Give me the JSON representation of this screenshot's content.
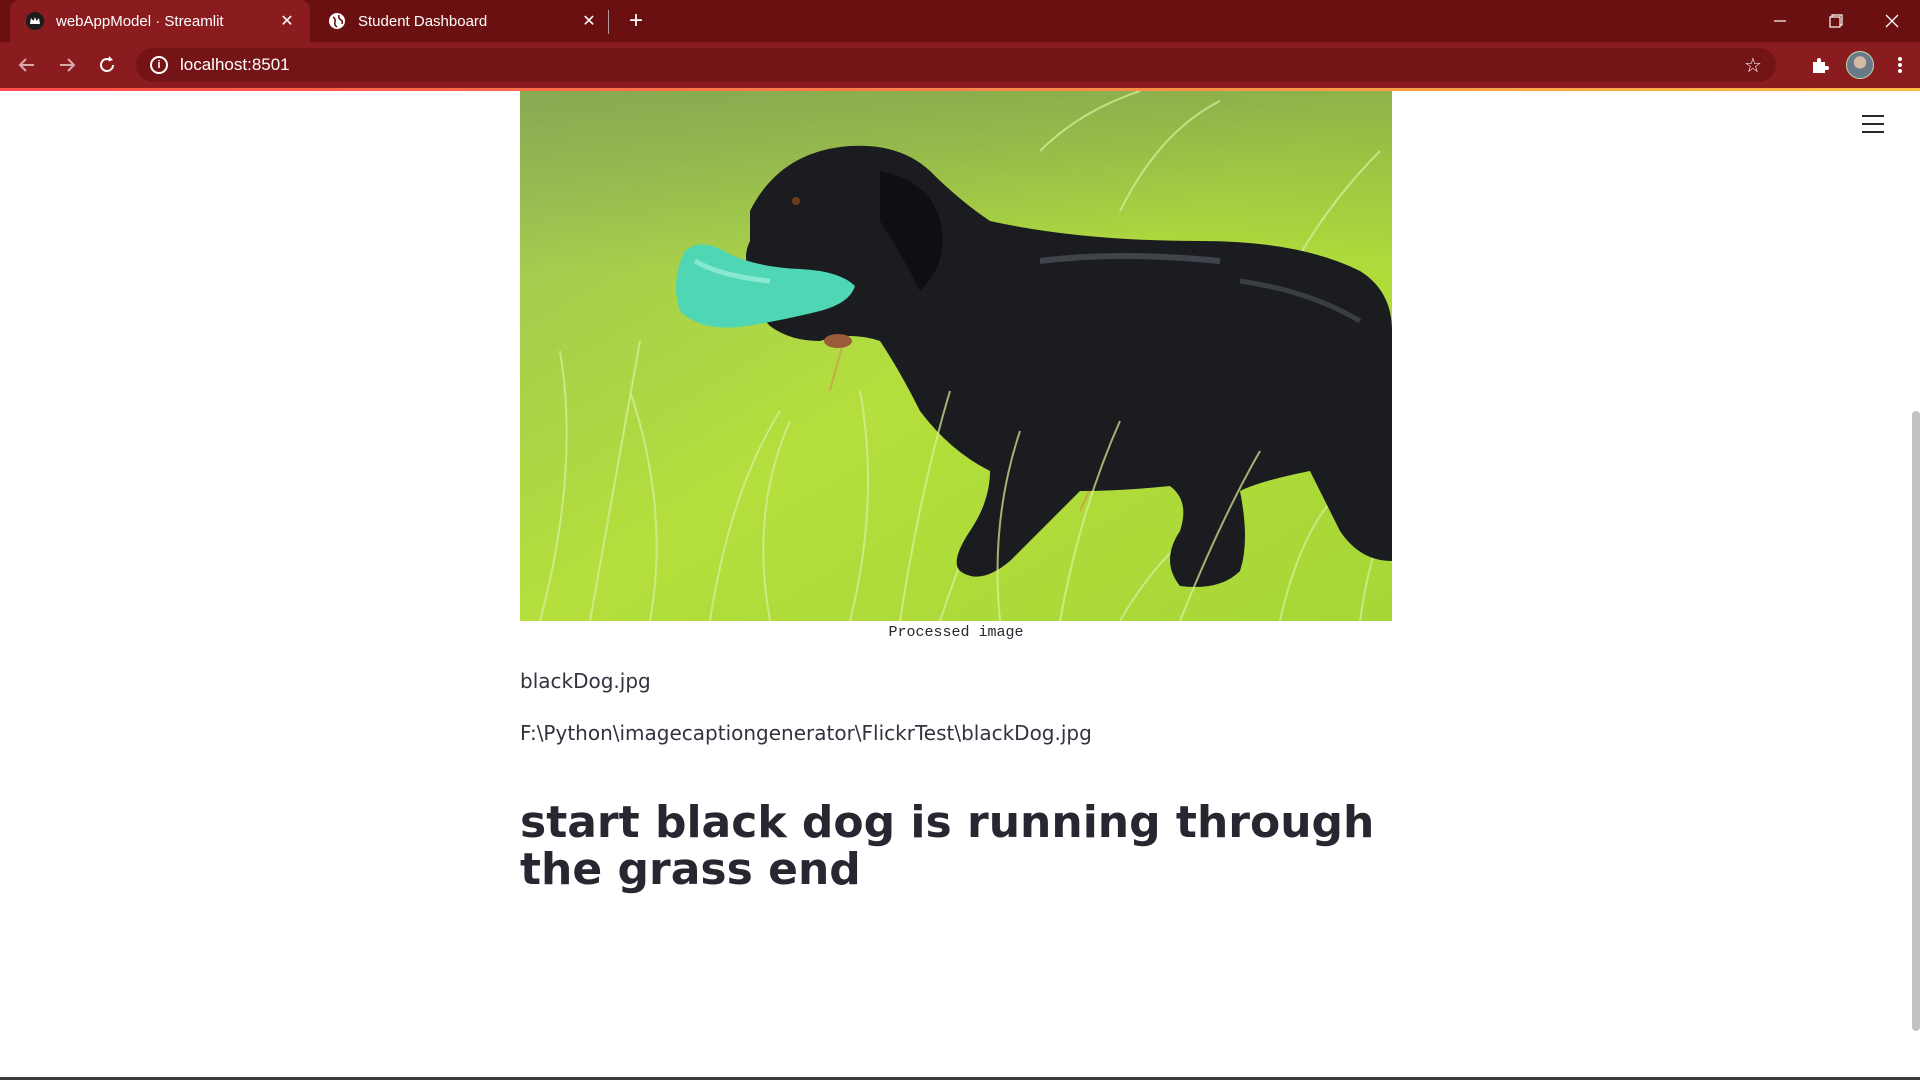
{
  "browser": {
    "tabs": [
      {
        "label": "webAppModel · Streamlit",
        "active": true,
        "icon": "streamlit-crown-icon"
      },
      {
        "label": "Student Dashboard",
        "active": false,
        "icon": "globe-icon"
      }
    ],
    "url": "localhost:8501",
    "colors": {
      "frame": "#6b1011",
      "toolbar": "#8a1b1f",
      "omnibox": "#751416"
    }
  },
  "app": {
    "image_caption_label": "Processed image",
    "filename": "blackDog.jpg",
    "filepath": "F:\\Python\\imagecaptiongenerator\\FlickrTest\\blackDog.jpg",
    "generated_caption": "start black dog is running through the grass end",
    "menu_icon": "hamburger-menu-icon"
  }
}
